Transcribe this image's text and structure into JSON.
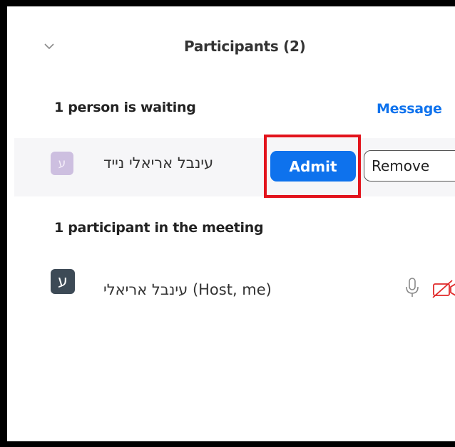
{
  "panel": {
    "title": "Participants (2)",
    "collapse_icon": "chevron-down-icon"
  },
  "waiting": {
    "label": "1 person is waiting",
    "message_label": "Message",
    "participant": {
      "name": "עינבל אריאלי נייד",
      "avatar_initial": "ע",
      "avatar_color": "#cdbfe0"
    },
    "admit_label": "Admit",
    "remove_label": "Remove"
  },
  "meeting": {
    "label": "1 participant in the meeting",
    "participant": {
      "name": "עינבל אריאלי",
      "suffix": " (Host, me)",
      "avatar_initial": "ע",
      "avatar_color": "#3d4a56",
      "mic_icon": "microphone-icon",
      "video_icon": "video-off-icon"
    }
  },
  "colors": {
    "accent": "#0e72ed",
    "highlight": "#e2131c",
    "video_off": "#e02828"
  }
}
